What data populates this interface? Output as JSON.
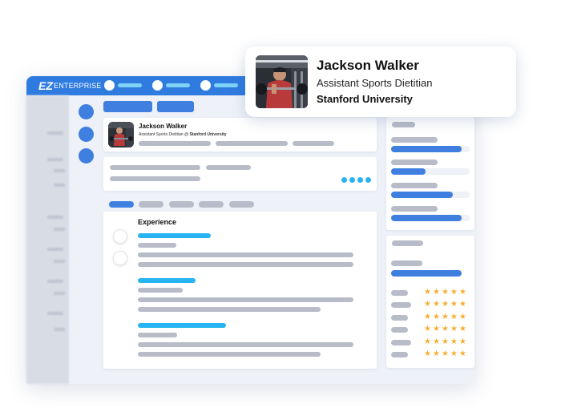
{
  "app": {
    "logo": "EZ",
    "name": "ENTERPRISE",
    "brand_color": "#2f7be0"
  },
  "popup": {
    "name": "Jackson Walker",
    "title": "Assistant Sports Dietitian",
    "org": "Stanford University"
  },
  "profile": {
    "name": "Jackson Walker",
    "subtitle_prefix": "Assistant Sports Dietitian @ ",
    "subtitle_org": "Stanford University"
  },
  "experience": {
    "heading": "Experience"
  },
  "skills": {
    "ratings": [
      5,
      5,
      5,
      5,
      5,
      5
    ]
  },
  "icons": [
    "avatar-photo",
    "star-icon",
    "timeline-dot-icon"
  ],
  "colors": {
    "accent": "#3f7fe0",
    "highlight": "#27b4f0",
    "star": "#f4b034",
    "placeholder": "#b7bcc8"
  }
}
